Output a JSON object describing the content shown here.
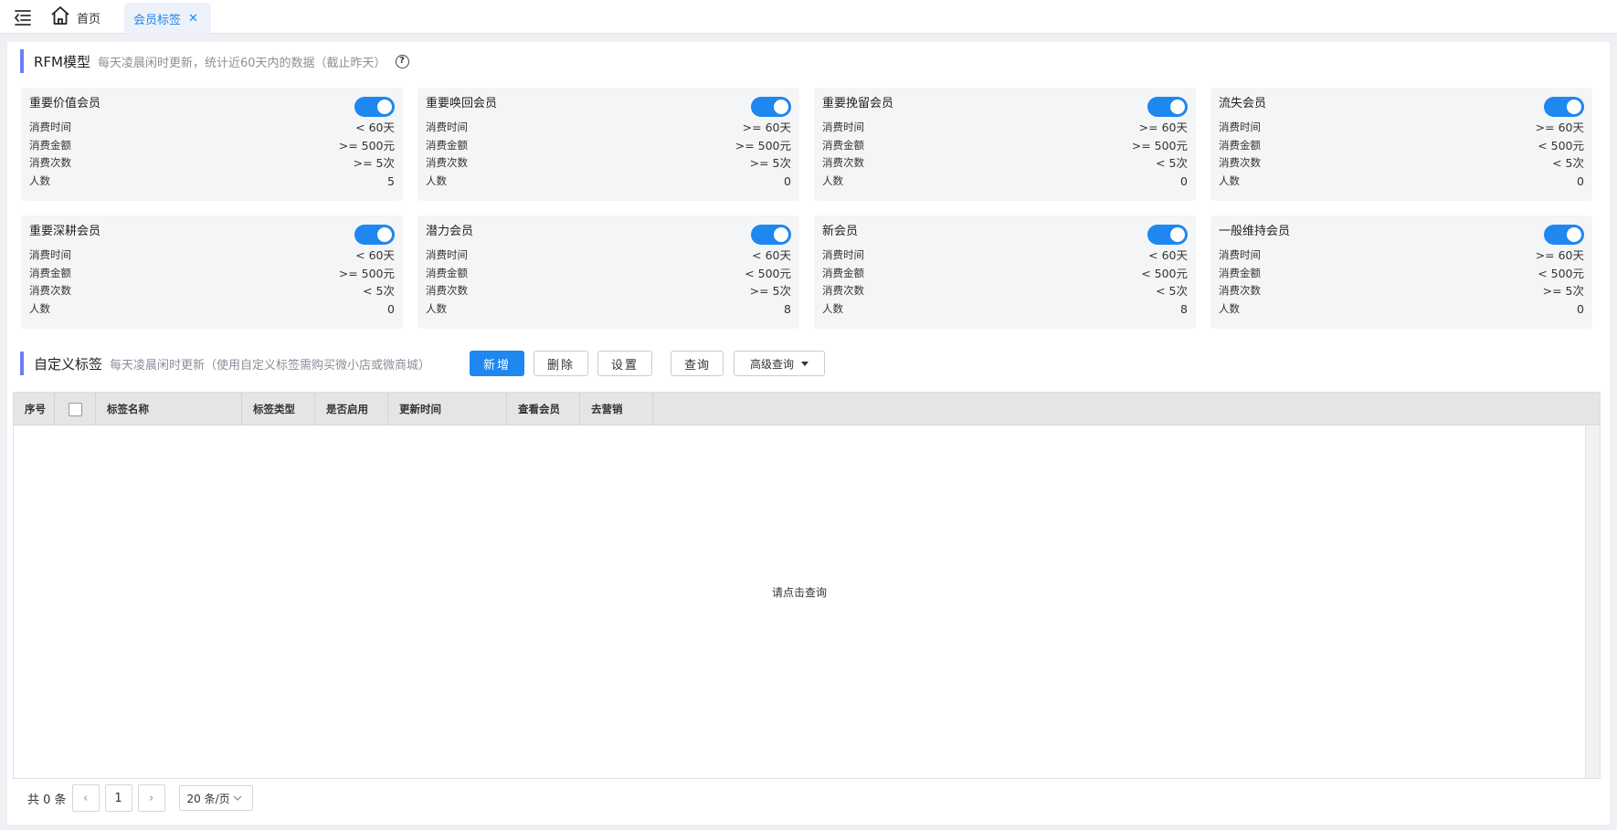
{
  "tabs": {
    "home_label": "首页",
    "active_label": "会员标签"
  },
  "rfm": {
    "title": "RFM模型",
    "desc": "每天凌晨闲时更新，统计近60天内的数据（截止昨天）",
    "labels": {
      "time": "消费时间",
      "amount": "消费金额",
      "count": "消费次数",
      "people": "人数"
    },
    "cards": [
      {
        "name": "重要价值会员",
        "enabled": true,
        "time": "< 60天",
        "amount": ">= 500元",
        "count": ">= 5次",
        "people": "5"
      },
      {
        "name": "重要唤回会员",
        "enabled": true,
        "time": ">= 60天",
        "amount": ">= 500元",
        "count": ">= 5次",
        "people": "0"
      },
      {
        "name": "重要挽留会员",
        "enabled": true,
        "time": ">= 60天",
        "amount": ">= 500元",
        "count": "< 5次",
        "people": "0"
      },
      {
        "name": "流失会员",
        "enabled": true,
        "time": ">= 60天",
        "amount": "< 500元",
        "count": "< 5次",
        "people": "0"
      },
      {
        "name": "重要深耕会员",
        "enabled": true,
        "time": "< 60天",
        "amount": ">= 500元",
        "count": "< 5次",
        "people": "0"
      },
      {
        "name": "潜力会员",
        "enabled": true,
        "time": "< 60天",
        "amount": "< 500元",
        "count": ">= 5次",
        "people": "8"
      },
      {
        "name": "新会员",
        "enabled": true,
        "time": "< 60天",
        "amount": "< 500元",
        "count": "< 5次",
        "people": "8"
      },
      {
        "name": "一般维持会员",
        "enabled": true,
        "time": ">= 60天",
        "amount": "< 500元",
        "count": ">= 5次",
        "people": "0"
      }
    ]
  },
  "custom": {
    "title": "自定义标签",
    "desc": "每天凌晨闲时更新（使用自定义标签需购买微小店或微商城）",
    "add_label": "新增",
    "delete_label": "删除",
    "settings_label": "设置",
    "query_label": "查询",
    "advanced_label": "高级查询"
  },
  "table": {
    "columns": [
      "序号",
      "",
      "标签名称",
      "标签类型",
      "是否启用",
      "更新时间",
      "查看会员",
      "去营销"
    ],
    "empty_text": "请点击查询"
  },
  "pager": {
    "total_label": "共 0 条",
    "page": "1",
    "page_size": "20 条/页",
    "prev_icon": "‹",
    "next_icon": "›"
  },
  "colors": {
    "accent": "#1e87f0",
    "section_bar": "#6c7ef5"
  }
}
